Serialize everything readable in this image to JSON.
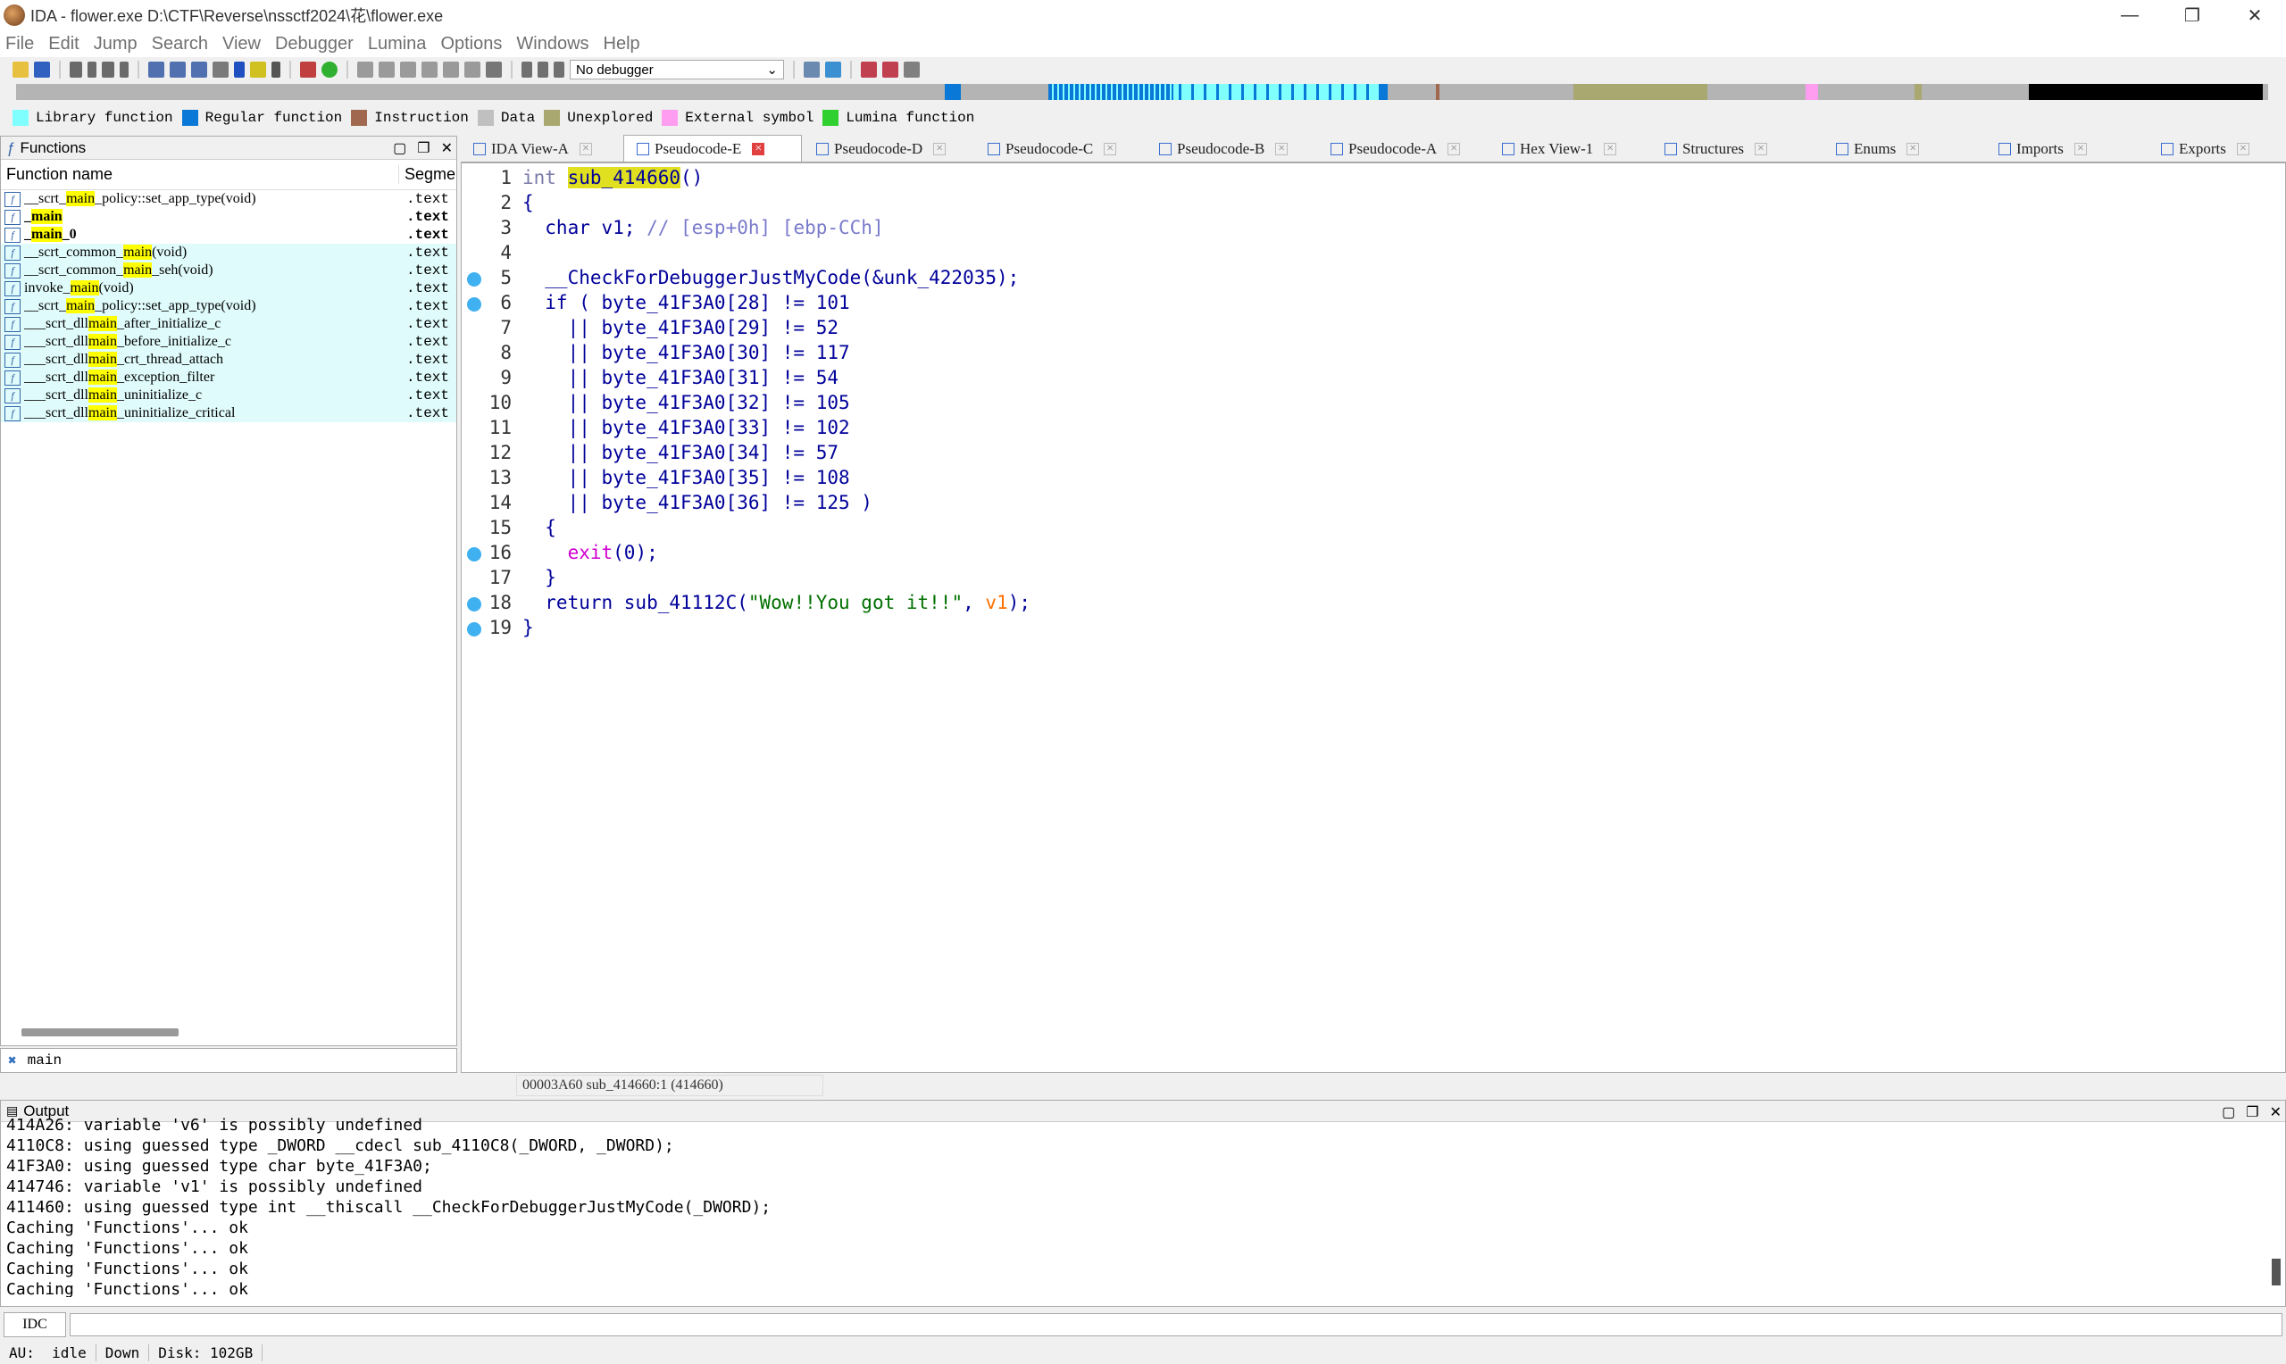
{
  "window": {
    "title": "IDA - flower.exe D:\\CTF\\Reverse\\nssctf2024\\花\\flower.exe",
    "controls": [
      "—",
      "❐",
      "✕"
    ]
  },
  "menu": [
    "File",
    "Edit",
    "Jump",
    "Search",
    "View",
    "Debugger",
    "Lumina",
    "Options",
    "Windows",
    "Help"
  ],
  "toolbar": {
    "debugger_select": "No debugger"
  },
  "legend": [
    {
      "label": "Library function",
      "color": "#80ffff"
    },
    {
      "label": "Regular function",
      "color": "#0a78d7"
    },
    {
      "label": "Instruction",
      "color": "#a0684f"
    },
    {
      "label": "Data",
      "color": "#c0c0c0"
    },
    {
      "label": "Unexplored",
      "color": "#a8a870"
    },
    {
      "label": "External symbol",
      "color": "#ff9df0"
    },
    {
      "label": "Lumina function",
      "color": "#30d030"
    }
  ],
  "functions": {
    "title": "Functions",
    "columns": [
      "Function name",
      "Segme"
    ],
    "rows": [
      {
        "pre": "__scrt_",
        "hl": "main",
        "post": "_policy::set_app_type(void)",
        "seg": ".text",
        "lib": false,
        "bold": false
      },
      {
        "pre": "_",
        "hl": "main",
        "post": "",
        "seg": ".text",
        "lib": false,
        "bold": true
      },
      {
        "pre": "_",
        "hl": "main",
        "post": "_0",
        "seg": ".text",
        "lib": false,
        "bold": true
      },
      {
        "pre": "__scrt_common_",
        "hl": "main",
        "post": "(void)",
        "seg": ".text",
        "lib": true,
        "bold": false
      },
      {
        "pre": "__scrt_common_",
        "hl": "main",
        "post": "_seh(void)",
        "seg": ".text",
        "lib": true,
        "bold": false
      },
      {
        "pre": "invoke_",
        "hl": "main",
        "post": "(void)",
        "seg": ".text",
        "lib": true,
        "bold": false
      },
      {
        "pre": "__scrt_",
        "hl": "main",
        "post": "_policy::set_app_type(void)",
        "seg": ".text",
        "lib": true,
        "bold": false
      },
      {
        "pre": "___scrt_dll",
        "hl": "main",
        "post": "_after_initialize_c",
        "seg": ".text",
        "lib": true,
        "bold": false
      },
      {
        "pre": "___scrt_dll",
        "hl": "main",
        "post": "_before_initialize_c",
        "seg": ".text",
        "lib": true,
        "bold": false
      },
      {
        "pre": "___scrt_dll",
        "hl": "main",
        "post": "_crt_thread_attach",
        "seg": ".text",
        "lib": true,
        "bold": false
      },
      {
        "pre": "___scrt_dll",
        "hl": "main",
        "post": "_exception_filter",
        "seg": ".text",
        "lib": true,
        "bold": false
      },
      {
        "pre": "___scrt_dll",
        "hl": "main",
        "post": "_uninitialize_c",
        "seg": ".text",
        "lib": true,
        "bold": false
      },
      {
        "pre": "___scrt_dll",
        "hl": "main",
        "post": "_uninitialize_critical",
        "seg": ".text",
        "lib": true,
        "bold": false
      }
    ],
    "filter": "main"
  },
  "tabs": [
    {
      "label": "IDA View-A",
      "active": false
    },
    {
      "label": "Pseudocode-E",
      "active": true
    },
    {
      "label": "Pseudocode-D",
      "active": false
    },
    {
      "label": "Pseudocode-C",
      "active": false
    },
    {
      "label": "Pseudocode-B",
      "active": false
    },
    {
      "label": "Pseudocode-A",
      "active": false
    },
    {
      "label": "Hex View-1",
      "active": false
    },
    {
      "label": "Structures",
      "active": false
    },
    {
      "label": "Enums",
      "active": false
    },
    {
      "label": "Imports",
      "active": false
    },
    {
      "label": "Exports",
      "active": false
    }
  ],
  "code": {
    "lines": [
      {
        "n": "1",
        "dot": false,
        "html": "<span class=\"gray\">int </span><span class=\"fnhl\">sub_414660</span>()"
      },
      {
        "n": "2",
        "dot": false,
        "html": "{"
      },
      {
        "n": "3",
        "dot": false,
        "html": "  char v1; <span class=\"cm\">// [esp+0h] [ebp-CCh]</span>"
      },
      {
        "n": "4",
        "dot": false,
        "html": ""
      },
      {
        "n": "5",
        "dot": true,
        "html": "  __CheckForDebuggerJustMyCode(&amp;unk_422035);"
      },
      {
        "n": "6",
        "dot": true,
        "html": "  if ( byte_41F3A0[28] != 101"
      },
      {
        "n": "7",
        "dot": false,
        "html": "    || byte_41F3A0[29] != 52"
      },
      {
        "n": "8",
        "dot": false,
        "html": "    || byte_41F3A0[30] != 117"
      },
      {
        "n": "9",
        "dot": false,
        "html": "    || byte_41F3A0[31] != 54"
      },
      {
        "n": "10",
        "dot": false,
        "html": "    || byte_41F3A0[32] != 105"
      },
      {
        "n": "11",
        "dot": false,
        "html": "    || byte_41F3A0[33] != 102"
      },
      {
        "n": "12",
        "dot": false,
        "html": "    || byte_41F3A0[34] != 57"
      },
      {
        "n": "13",
        "dot": false,
        "html": "    || byte_41F3A0[35] != 108"
      },
      {
        "n": "14",
        "dot": false,
        "html": "    || byte_41F3A0[36] != 125 )"
      },
      {
        "n": "15",
        "dot": false,
        "html": "  {"
      },
      {
        "n": "16",
        "dot": true,
        "html": "    <span class=\"fn-pink\">exit</span>(0);"
      },
      {
        "n": "17",
        "dot": false,
        "html": "  }"
      },
      {
        "n": "18",
        "dot": true,
        "html": "  return sub_41112C(<span class=\"str\">\"Wow!!You got it!!\"</span>, <span class=\"var-orange\">v1</span>);"
      },
      {
        "n": "19",
        "dot": true,
        "html": "}"
      }
    ],
    "status": "00003A60 sub_414660:1 (414660)"
  },
  "output": {
    "title": "Output",
    "lines": [
      "414A26: variable 'v6' is possibly undefined",
      "4110C8: using guessed type _DWORD __cdecl sub_4110C8(_DWORD, _DWORD);",
      "41F3A0: using guessed type char byte_41F3A0;",
      "414746: variable 'v1' is possibly undefined",
      "411460: using guessed type int __thiscall __CheckForDebuggerJustMyCode(_DWORD);",
      "Caching 'Functions'... ok",
      "Caching 'Functions'... ok",
      "Caching 'Functions'... ok",
      "Caching 'Functions'... ok"
    ]
  },
  "idc": {
    "label": "IDC"
  },
  "status": {
    "au": "AU:",
    "state": "idle",
    "dir": "Down",
    "disk": "Disk: 102GB"
  }
}
